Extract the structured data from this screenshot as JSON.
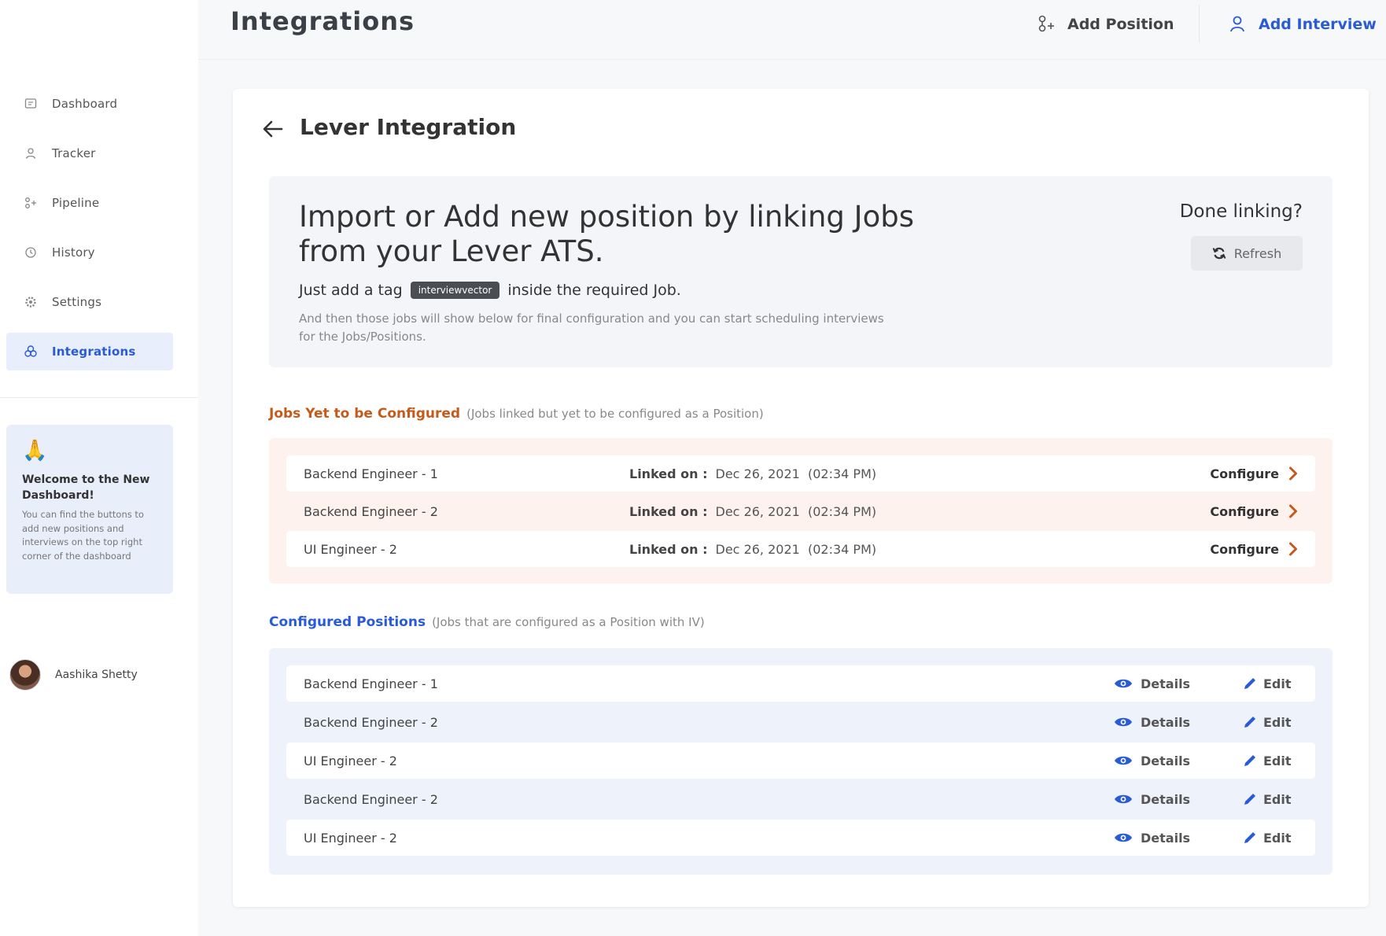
{
  "header": {
    "title": "Integrations",
    "add_position": "Add Position",
    "add_interview": "Add Interview"
  },
  "sidebar": {
    "items": [
      {
        "label": "Dashboard",
        "icon": "dashboard-icon"
      },
      {
        "label": "Tracker",
        "icon": "user-icon"
      },
      {
        "label": "Pipeline",
        "icon": "pipeline-icon"
      },
      {
        "label": "History",
        "icon": "clock-icon"
      },
      {
        "label": "Settings",
        "icon": "gear-icon"
      },
      {
        "label": "Integrations",
        "icon": "integrations-icon",
        "active": true
      }
    ],
    "welcome": {
      "emoji": "🙏",
      "title": "Welcome to the New Dashboard!",
      "text": "You can find the buttons to add new positions and interviews on the top right corner of the dashboard"
    },
    "user": {
      "name": "Aashika Shetty"
    }
  },
  "card": {
    "title": "Lever Integration",
    "info": {
      "heading": "Import or Add new position by linking Jobs from your Lever ATS.",
      "tag_prefix": "Just add a tag",
      "tag": "interviewvector",
      "tag_suffix": "inside the required Job.",
      "description": "And then those jobs will show below for final configuration and you can start scheduling interviews for the Jobs/Positions.",
      "done_label": "Done linking?",
      "refresh_label": "Refresh"
    },
    "jobs_section": {
      "title": "Jobs Yet to be Configured",
      "subtitle": "(Jobs linked but yet to be configured as a Position)",
      "linked_label": "Linked on :",
      "configure_label": "Configure",
      "rows": [
        {
          "name": "Backend Engineer - 1",
          "date": "Dec 26, 2021",
          "time": "(02:34 PM)"
        },
        {
          "name": "Backend Engineer - 2",
          "date": "Dec 26, 2021",
          "time": "(02:34 PM)"
        },
        {
          "name": "UI Engineer - 2",
          "date": "Dec 26, 2021",
          "time": "(02:34 PM)"
        }
      ]
    },
    "configured_section": {
      "title": "Configured Positions",
      "subtitle": "(Jobs that are configured as a Position with IV)",
      "details_label": "Details",
      "edit_label": "Edit",
      "rows": [
        {
          "name": "Backend Engineer - 1"
        },
        {
          "name": "Backend Engineer - 2"
        },
        {
          "name": "UI Engineer - 2"
        },
        {
          "name": "Backend Engineer - 2"
        },
        {
          "name": "UI Engineer - 2"
        }
      ]
    }
  },
  "colors": {
    "accent": "#2a5bd7",
    "warning": "#c55a1a",
    "jobs_panel_bg": "#fdf2ee",
    "configured_panel_bg": "#eef2fb"
  }
}
